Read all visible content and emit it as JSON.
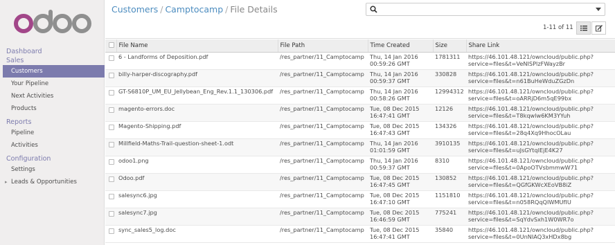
{
  "sidebar": {
    "sections": [
      {
        "label": "Dashboard",
        "items": []
      },
      {
        "label": "Sales",
        "items": [
          "Customers",
          "Your Pipeline",
          "Next Activities",
          "Products"
        ]
      },
      {
        "label": "Reports",
        "items": [
          "Pipeline",
          "Activities"
        ]
      },
      {
        "label": "Configuration",
        "items": [
          "Settings",
          "Leads & Opportunities"
        ]
      }
    ],
    "active_item": "Customers"
  },
  "breadcrumb": {
    "customers": "Customers",
    "company": "Camptocamp",
    "current": "File Details",
    "sep": "/"
  },
  "search": {
    "placeholder": "",
    "value": ""
  },
  "pager": {
    "text": "1-11 of 11"
  },
  "table": {
    "columns": [
      "File Name",
      "File Path",
      "Time Created",
      "Size",
      "Share Link"
    ],
    "rows": [
      {
        "name": "6 - Landforms of Deposition.pdf",
        "path": "/res_partner/11_Camptocamp",
        "time": "Thu, 14 Jan 2016 00:59:26 GMT",
        "size": "1781311",
        "link": "https://46.101.48.121/owncloud/public.php?service=files&t=VeNISPlzFWayzBr"
      },
      {
        "name": "billy-harper-discography.pdf",
        "path": "/res_partner/11_Camptocamp",
        "time": "Thu, 14 Jan 2016 00:59:37 GMT",
        "size": "330828",
        "link": "https://46.101.48.121/owncloud/public.php?service=files&t=n61BuHeWduZGzDn"
      },
      {
        "name": "GT-S6810P_UM_EU_Jellybean_Eng_Rev.1.1_130306.pdf",
        "path": "/res_partner/11_Camptocamp",
        "time": "Thu, 14 Jan 2016 00:58:26 GMT",
        "size": "12994312",
        "link": "https://46.101.48.121/owncloud/public.php?service=files&t=oARRjD6m5qE99bx"
      },
      {
        "name": "magento-errors.doc",
        "path": "/res_partner/11_Camptocamp",
        "time": "Tue, 08 Dec 2015 16:47:41 GMT",
        "size": "12126",
        "link": "https://46.101.48.121/owncloud/public.php?service=files&t=T8kqwlw6KM3YYuh"
      },
      {
        "name": "Magento-Shipping.pdf",
        "path": "/res_partner/11_Camptocamp",
        "time": "Tue, 08 Dec 2015 16:47:43 GMT",
        "size": "134326",
        "link": "https://46.101.48.121/owncloud/public.php?service=files&t=28q4Xq9HhocOLau"
      },
      {
        "name": "Millfield-Maths-Trail-question-sheet-1.odt",
        "path": "/res_partner/11_Camptocamp",
        "time": "Thu, 14 Jan 2016 01:01:59 GMT",
        "size": "3910135",
        "link": "https://46.101.48.121/owncloud/public.php?service=files&t=uJsGYtqIEjE4K27"
      },
      {
        "name": "odoo1.png",
        "path": "/res_partner/11_Camptocamp",
        "time": "Thu, 14 Jan 2016 00:59:37 GMT",
        "size": "8310",
        "link": "https://46.101.48.121/owncloud/public.php?service=files&t=0ApoOTVsbmmwW71"
      },
      {
        "name": "Odoo.pdf",
        "path": "/res_partner/11_Camptocamp",
        "time": "Tue, 08 Dec 2015 16:47:45 GMT",
        "size": "130852",
        "link": "https://46.101.48.121/owncloud/public.php?service=files&t=QGfGKWcXEoVB8iZ"
      },
      {
        "name": "salesync6.jpg",
        "path": "/res_partner/11_Camptocamp",
        "time": "Tue, 08 Dec 2015 16:47:10 GMT",
        "size": "1151810",
        "link": "https://46.101.48.121/owncloud/public.php?service=files&t=n058RQqQIWMUfIU"
      },
      {
        "name": "salesync7.jpg",
        "path": "/res_partner/11_Camptocamp",
        "time": "Tue, 08 Dec 2015 16:46:59 GMT",
        "size": "775241",
        "link": "https://46.101.48.121/owncloud/public.php?service=files&t=SqYdvSxh1W0WR7o"
      },
      {
        "name": "sync_sales5_log.doc",
        "path": "/res_partner/11_Camptocamp",
        "time": "Tue, 08 Dec 2015 16:47:41 GMT",
        "size": "35840",
        "link": "https://46.101.48.121/owncloud/public.php?service=files&t=0UnNIAQ3xHDx8bg"
      }
    ]
  },
  "colors": {
    "brand": "#7c7bad",
    "link": "#4c8cbf"
  },
  "icons": {
    "search": "search-icon",
    "list_view": "list-view-icon",
    "form_view": "form-view-icon"
  }
}
